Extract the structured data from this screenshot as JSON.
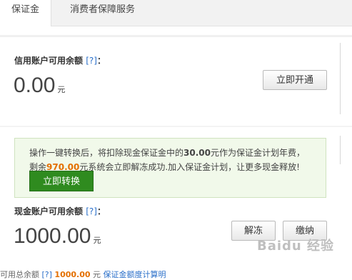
{
  "tabs": [
    {
      "label": "保证金",
      "active": true
    },
    {
      "label": "消费者保障服务",
      "active": false
    }
  ],
  "credit": {
    "label": "信用账户可用余额",
    "help": "[?]",
    "colon": "：",
    "amount": "0.00",
    "unit": "元",
    "action": "立即开通"
  },
  "notice": {
    "line1_a": "操作一键转换后，将扣除现金保证金中的",
    "line1_amount": "30.00",
    "line1_b": "元作为保证金计划年费，",
    "line2_a": "剩余",
    "line2_amount": "970.00",
    "line2_b": "元系统会立即解冻成功.加入保证金计划，让更多现金释放!",
    "action": "立即转换"
  },
  "cash": {
    "label": "现金账户可用余额",
    "help": "[?]",
    "colon": "：",
    "amount": "1000.00",
    "unit": "元",
    "actions": [
      "解冻",
      "缴纳"
    ]
  },
  "bottom": {
    "text_a": "可用总余额",
    "help": "[?]",
    "amount": "1000.00",
    "unit": "元",
    "link": "保证金额度计算明"
  },
  "watermark": "Baidu 经验"
}
